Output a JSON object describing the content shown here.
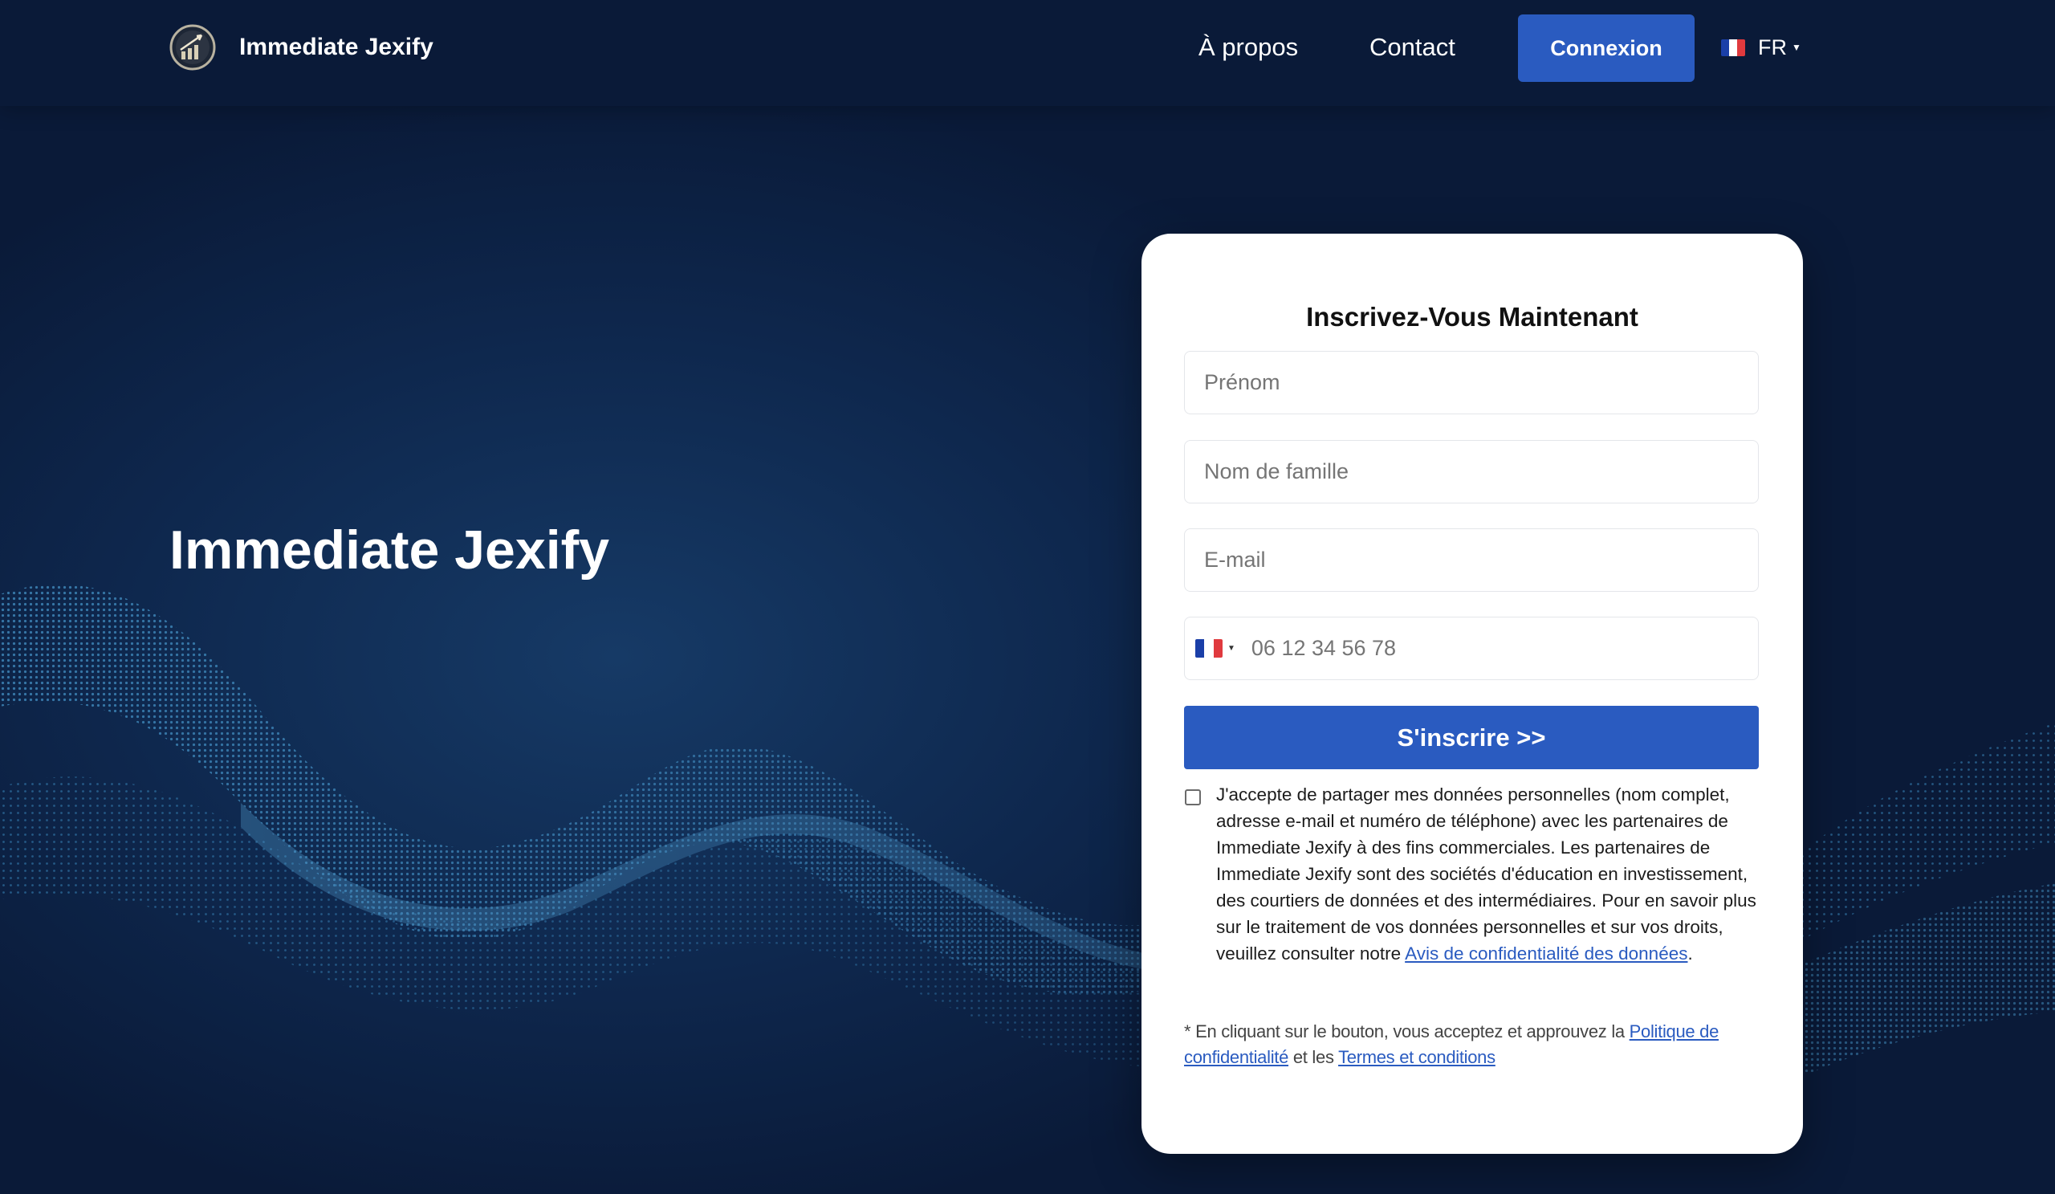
{
  "header": {
    "brand_name": "Immediate Jexify",
    "logo_icon": "rocket-chart-logo-icon",
    "nav": {
      "about_label": "À propos",
      "contact_label": "Contact"
    },
    "login_label": "Connexion",
    "language": {
      "code": "FR",
      "flag_icon": "france-flag-icon"
    }
  },
  "hero": {
    "title": "Immediate Jexify"
  },
  "form": {
    "title": "Inscrivez-Vous Maintenant",
    "first_name_placeholder": "Prénom",
    "last_name_placeholder": "Nom de famille",
    "email_placeholder": "E-mail",
    "phone": {
      "country_flag_icon": "france-flag-icon",
      "placeholder": "06 12 34 56 78"
    },
    "submit_label": "S'inscrire >>",
    "consent": {
      "checked": false,
      "text": "J'accepte de partager mes données personnelles (nom complet, adresse e-mail et numéro de téléphone) avec les partenaires de Immediate Jexify à des fins commerciales. Les partenaires de Immediate Jexify sont des sociétés d'éducation en investissement, des courtiers de données et des intermédiaires. Pour en savoir plus sur le traitement de vos données personnelles et sur vos droits, veuillez consulter notre ",
      "link_label": "Avis de confidentialité des données",
      "suffix": "."
    },
    "disclaimer": {
      "prefix": "* En cliquant sur le bouton, vous acceptez et approuvez la ",
      "privacy_link": "Politique de confidentialité",
      "middle": " et les ",
      "terms_link": "Termes et conditions"
    }
  },
  "colors": {
    "background": "#0a1a38",
    "accent": "#2a5bc0",
    "wave": "#3f8fc4",
    "flag_blue": "#1a3fa8",
    "flag_white": "#ffffff",
    "flag_red": "#e03a3e"
  }
}
